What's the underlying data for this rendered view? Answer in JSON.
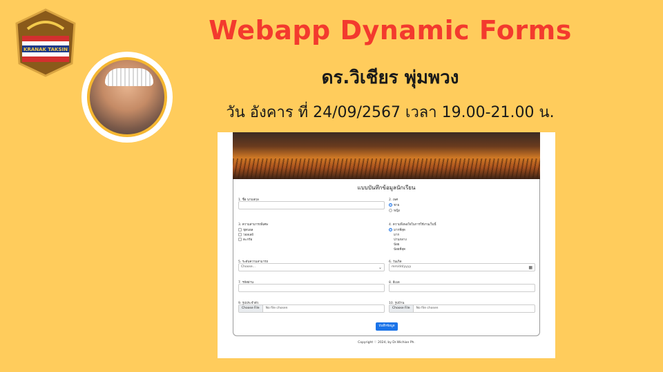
{
  "header": {
    "title": "Webapp Dynamic Forms",
    "author": "ดร.วิเชียร พุ่มพวง",
    "date_line": "วัน อังคาร ที่ 24/09/2567 เวลา 19.00-21.00 น."
  },
  "logo": {
    "text": "KRANAK TAKSIN"
  },
  "form": {
    "title": "แบบบันทึกข้อมูลนักเรียน",
    "f1_label": "1. ชื่อ นามสกุล",
    "f2_label": "2. เพศ",
    "f2_options": [
      "ชาย",
      "หญิง"
    ],
    "f3_label": "3. ความสามารถพิเศษ",
    "f3_options": [
      "ฟุตบอล",
      "วอลเลย์",
      "ตะกร้อ"
    ],
    "f4_label": "4. ความพึงพอใจในการใช้งานเว็บนี้",
    "f4_options": [
      "มากที่สุด",
      "มาก",
      "ปานกลาง",
      "น้อย",
      "น้อยที่สุด"
    ],
    "f5_label": "5. ระดับความสามารถ",
    "f5_value": "Choose...",
    "f6_label": "6. วันเกิด",
    "f6_placeholder": "mm/dd/yyyy",
    "f7_label": "7. รหัสผ่าน",
    "f8_label": "8. อีเมล",
    "f9_label": "9. รูปประจำตัว",
    "f10_label": "10. รูปบ้าน",
    "file_button": "Choose File",
    "file_status": "No file chosen",
    "submit_label": "บันทึกข้อมูล",
    "footer": "Copyright ♡ 2024, by Dr.Wichian Ph."
  },
  "colors": {
    "background": "#ffcc5c",
    "title": "#f33a2e",
    "accent": "#1a73e8"
  }
}
